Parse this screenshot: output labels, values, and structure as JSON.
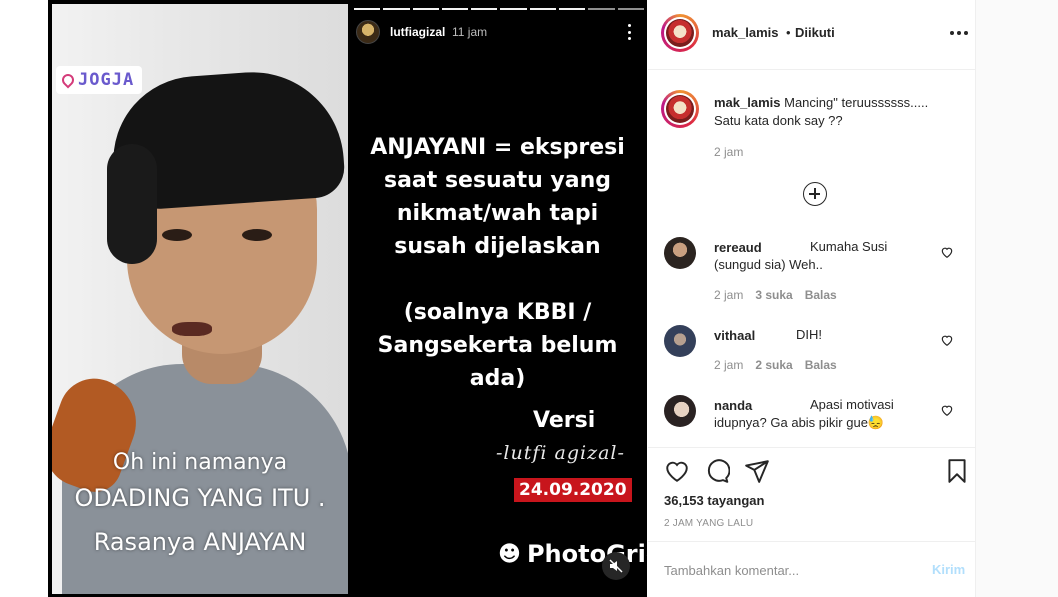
{
  "story": {
    "location_tag": "JOGJA",
    "subtitles": [
      "Oh ini namanya",
      "ODADING YANG ITU .",
      "Rasanya ANJAYAN"
    ],
    "author_username": "lutfiagizal",
    "time": "11 jam",
    "lines": [
      "ANJAYANI = ekspresi",
      "saat sesuatu yang",
      "nikmat/wah tapi",
      "susah dijelaskan",
      "",
      "(soalnya KBBI /",
      "Sangsekerta belum",
      "ada)"
    ],
    "versi": "Versi",
    "signature": "-lutfi agizal-",
    "date": "24.09.2020",
    "watermark": "PhotoGrid"
  },
  "post": {
    "username": "mak_lamis",
    "dot": "•",
    "follow_status": "Diikuti",
    "caption": {
      "username": "mak_lamis",
      "text_line1": "Mancing\" teruussssss.....",
      "text_line2": "Satu kata donk say ??",
      "time": "2 jam"
    },
    "comments": [
      {
        "username": "rereaud",
        "text1": "Kumaha Susi",
        "text2": "(sungud sia) Weh..",
        "time": "2 jam",
        "likes": "3 suka",
        "reply": "Balas"
      },
      {
        "username": "vithaal",
        "text1": "DIH!",
        "text2": "",
        "time": "2 jam",
        "likes": "2 suka",
        "reply": "Balas"
      },
      {
        "username": "nanda",
        "text1": "Apasi motivasi",
        "text2": "idupnya? Ga abis pikir gue😓",
        "time": "",
        "likes": "",
        "reply": ""
      }
    ],
    "views": "36,153 tayangan",
    "ago": "2 JAM YANG LALU",
    "comment_placeholder": "Tambahkan komentar...",
    "send_label": "Kirim"
  }
}
